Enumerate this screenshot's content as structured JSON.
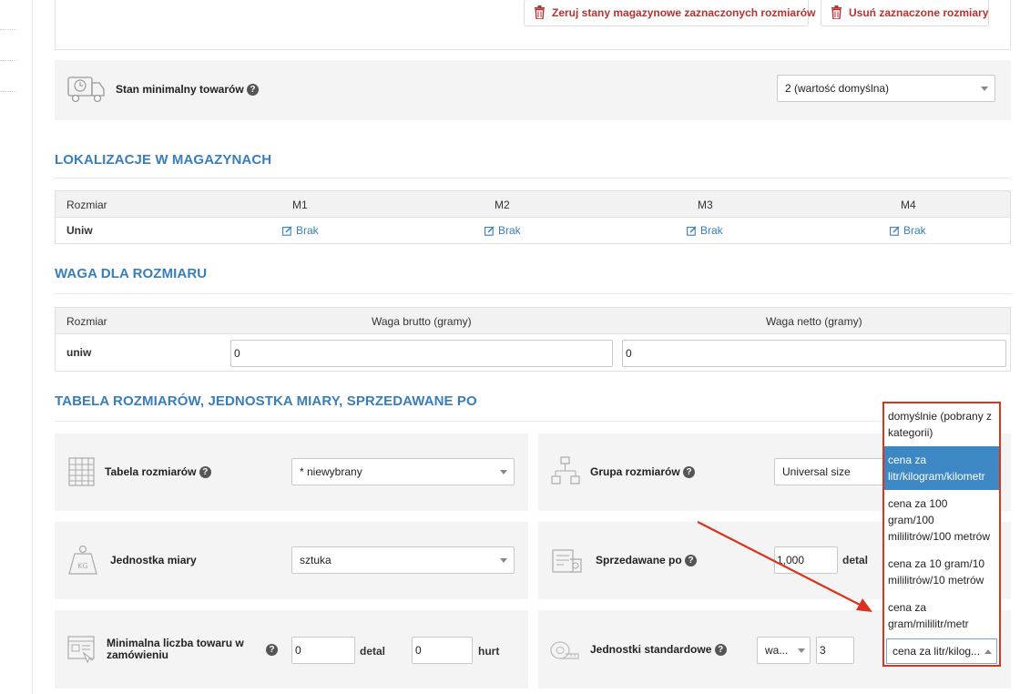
{
  "toolbar": {
    "reset_stock_label": "Zeruj stany magazynowe zaznaczonych rozmiarów",
    "delete_sizes_label": "Usuń zaznaczone rozmiary"
  },
  "min_stock": {
    "label": "Stan minimalny towarów",
    "select_value": "2 (wartość domyślna)"
  },
  "locations": {
    "title": "LOKALIZACJE W MAGAZYNACH",
    "headers": [
      "Rozmiar",
      "M1",
      "M2",
      "M3",
      "M4"
    ],
    "row": {
      "size": "Uniw",
      "values": [
        "Brak",
        "Brak",
        "Brak",
        "Brak"
      ]
    }
  },
  "weight": {
    "title": "WAGA DLA ROZMIARU",
    "headers": [
      "Rozmiar",
      "Waga brutto (gramy)",
      "Waga netto (gramy)"
    ],
    "row": {
      "size": "uniw",
      "gross": "0",
      "net": "0"
    }
  },
  "sizes_table": {
    "title": "TABELA ROZMIARÓW, JEDNOSTKA MIARY, SPRZEDAWANE PO",
    "size_table_label": "Tabela rozmiarów",
    "size_table_value": "* niewybrany",
    "size_group_label": "Grupa rozmiarów",
    "size_group_value": "Universal size",
    "unit_label": "Jednostka miary",
    "unit_value": "sztuka",
    "sold_by_label": "Sprzedawane po",
    "sold_by_value": "1,000",
    "sold_by_unit": "detal",
    "min_order_label": "Minimalna liczba towaru w zamówieniu",
    "min_retail_value": "0",
    "min_retail_unit": "detal",
    "min_wholesale_value": "0",
    "min_wholesale_unit": "hurt",
    "std_units_label": "Jednostki standardowe",
    "std_units_select": "wa...",
    "std_units_value": "3",
    "std_units_dropdown_value": "cena za litr/kilog..."
  },
  "dropdown_options": [
    "domyślnie (pobrany z kategorii)",
    "cena za litr/kilogram/kilometr",
    "cena za 100 gram/100 mililitrów/100 metrów",
    "cena za 10 gram/10 mililitrów/10 metrów",
    "cena za gram/mililitr/metr"
  ],
  "colors": {
    "accent_blue": "#3a7eb9",
    "danger_red": "#b83232",
    "highlight_red": "#d9341d",
    "selected_option": "#3d88c4"
  }
}
